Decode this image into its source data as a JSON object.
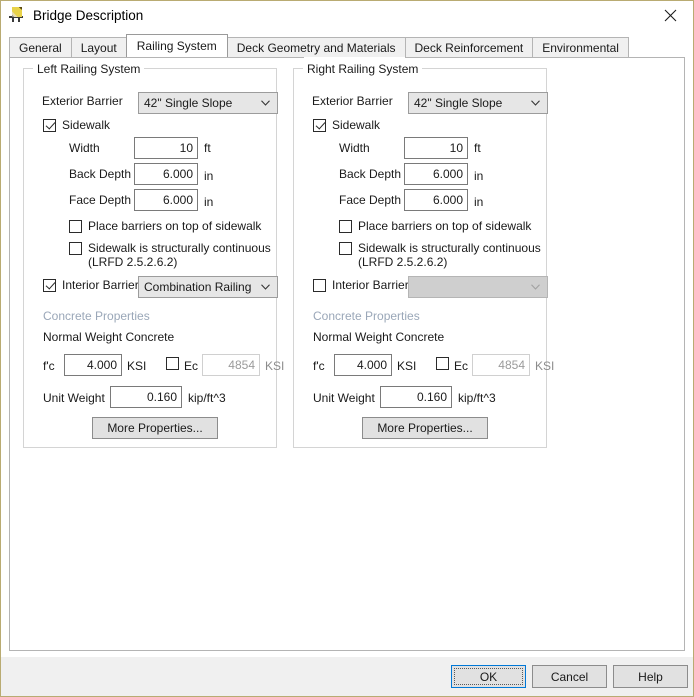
{
  "window": {
    "title": "Bridge Description",
    "icon": "bridge-pencil-icon",
    "close_label": "✕",
    "border_color": "#b9ab72"
  },
  "tabs": [
    {
      "label": "General",
      "active": false
    },
    {
      "label": "Layout",
      "active": false
    },
    {
      "label": "Railing System",
      "active": true
    },
    {
      "label": "Deck Geometry and Materials",
      "active": false
    },
    {
      "label": "Deck Reinforcement",
      "active": false
    },
    {
      "label": "Environmental",
      "active": false
    }
  ],
  "left_panel": {
    "title": "Left Railing System",
    "exterior_barrier_label": "Exterior Barrier",
    "exterior_barrier_value": "42\" Single Slope",
    "sidewalk_label": "Sidewalk",
    "sidewalk_checked": true,
    "width_label": "Width",
    "width_value": "10",
    "width_unit": "ft",
    "back_depth_label": "Back Depth",
    "back_depth_value": "6.000",
    "back_depth_unit": "in",
    "face_depth_label": "Face Depth",
    "face_depth_value": "6.000",
    "face_depth_unit": "in",
    "place_barriers_label": "Place barriers on top of sidewalk",
    "place_barriers_checked": false,
    "structurally_continuous_label_line1": "Sidewalk is structurally continuous",
    "structurally_continuous_label_line2": "(LRFD 2.5.2.6.2)",
    "structurally_continuous_checked": false,
    "interior_barrier_label": "Interior Barrier",
    "interior_barrier_checked": true,
    "interior_barrier_value": "Combination Railing",
    "concrete_properties_label": "Concrete Properties",
    "concrete_type_label": "Normal Weight Concrete",
    "fc_label": "f'c",
    "fc_value": "4.000",
    "fc_unit": "KSI",
    "ec_label": "Ec",
    "ec_checked": false,
    "ec_value": "4854",
    "ec_unit": "KSI",
    "unit_weight_label": "Unit Weight",
    "unit_weight_value": "0.160",
    "unit_weight_unit": "kip/ft^3",
    "more_properties_label": "More Properties..."
  },
  "right_panel": {
    "title": "Right Railing System",
    "exterior_barrier_label": "Exterior Barrier",
    "exterior_barrier_value": "42\" Single Slope",
    "sidewalk_label": "Sidewalk",
    "sidewalk_checked": true,
    "width_label": "Width",
    "width_value": "10",
    "width_unit": "ft",
    "back_depth_label": "Back Depth",
    "back_depth_value": "6.000",
    "back_depth_unit": "in",
    "face_depth_label": "Face Depth",
    "face_depth_value": "6.000",
    "face_depth_unit": "in",
    "place_barriers_label": "Place barriers on top of sidewalk",
    "place_barriers_checked": false,
    "structurally_continuous_label_line1": "Sidewalk is structurally continuous",
    "structurally_continuous_label_line2": "(LRFD 2.5.2.6.2)",
    "structurally_continuous_checked": false,
    "interior_barrier_label": "Interior Barrier",
    "interior_barrier_checked": false,
    "interior_barrier_value": "",
    "concrete_properties_label": "Concrete Properties",
    "concrete_type_label": "Normal Weight Concrete",
    "fc_label": "f'c",
    "fc_value": "4.000",
    "fc_unit": "KSI",
    "ec_label": "Ec",
    "ec_checked": false,
    "ec_value": "4854",
    "ec_unit": "KSI",
    "unit_weight_label": "Unit Weight",
    "unit_weight_value": "0.160",
    "unit_weight_unit": "kip/ft^3",
    "more_properties_label": "More Properties..."
  },
  "footer": {
    "ok_label": "OK",
    "cancel_label": "Cancel",
    "help_label": "Help",
    "focus_color": "#0078d7"
  }
}
